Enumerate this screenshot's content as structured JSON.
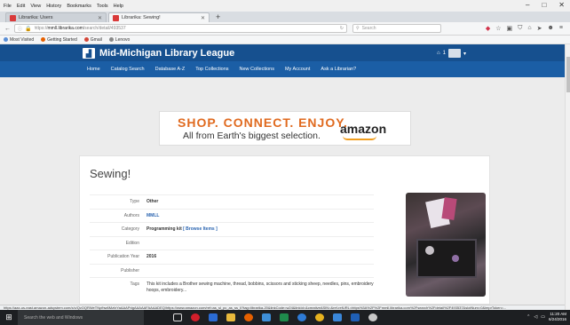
{
  "browser": {
    "menu": [
      "File",
      "Edit",
      "View",
      "History",
      "Bookmarks",
      "Tools",
      "Help"
    ],
    "window_controls": [
      "–",
      "□",
      "✕"
    ],
    "tabs": [
      {
        "label": "Librarika: Users",
        "active": false
      },
      {
        "label": "Librarika: Sewing!",
        "active": true
      }
    ],
    "new_tab": "+",
    "url_host": "mmll.librarika.com",
    "url_path": "/search/detail/493537",
    "url_prefix": "https://",
    "search_placeholder": "Search",
    "bookmarks": [
      "Most Visited",
      "Getting Started",
      "Gmail",
      "Lenovo"
    ],
    "status_url": "https://aax-us-east.amazon-adsystem.com/x/c/QvOQRWeTNpfhw6MzfzYaAAAPdgAAAAAFAAAADEQ/https://www.amazon.com/ref=as_sl_pc_as_ss_li?tag=librarika-20&linkCode=w24&linkId=&creativeASIN=&ref-refURL=https%3A%2F%2Fmmll.librarika.com%2Fsearch%2Fdetail%2F493537&slotNum=0&imprToken=..."
  },
  "site": {
    "title": "Mid-Michigan Library League",
    "account_count": "1",
    "nav": [
      "Home",
      "Catalog Search",
      "Database A-Z",
      "Top Collections",
      "New Collections",
      "My Account",
      "Ask a Librarian?"
    ]
  },
  "ad": {
    "line1": "SHOP.  CONNECT.  ENJOY.",
    "line2": "All from Earth's biggest selection.",
    "brand": "amazon"
  },
  "item": {
    "title": "Sewing!",
    "fields": [
      {
        "key": "Type",
        "value": "Other"
      },
      {
        "key": "Authors",
        "value": "MMLL"
      },
      {
        "key": "Category",
        "value": "Programming kit",
        "link": "[ Browse Items ]"
      },
      {
        "key": "Edition",
        "value": ""
      },
      {
        "key": "Publication Year",
        "value": "2016"
      },
      {
        "key": "Publisher",
        "value": ""
      },
      {
        "key": "Tags",
        "value": "This kit includes a Brother sewing machine, thread, bobbins, scissors and sticking sheep, needles, pins, embroidery hoops, embroidery..."
      }
    ]
  },
  "taskbar": {
    "search_placeholder": "Search the web and Windows",
    "time": "11:20 AM",
    "date": "6/24/2016"
  }
}
